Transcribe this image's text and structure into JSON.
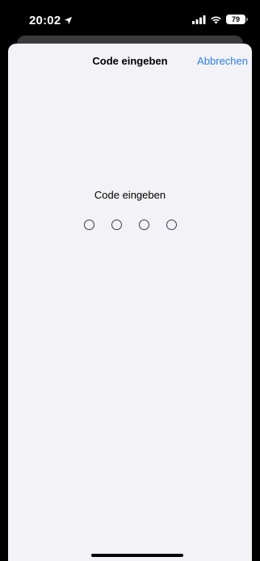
{
  "status_bar": {
    "time": "20:02",
    "battery_level": "79",
    "icons": [
      "location-arrow-icon",
      "cellular-signal-icon",
      "wifi-icon",
      "battery-icon"
    ]
  },
  "sheet": {
    "title": "Code eingeben",
    "cancel_label": "Abbrechen"
  },
  "passcode": {
    "prompt": "Code eingeben",
    "digits_total": 4,
    "digits_entered": 0
  },
  "colors": {
    "accent": "#2b7ef0",
    "sheet_background": "#f2f2f7",
    "status_bar_background": "#000000"
  }
}
